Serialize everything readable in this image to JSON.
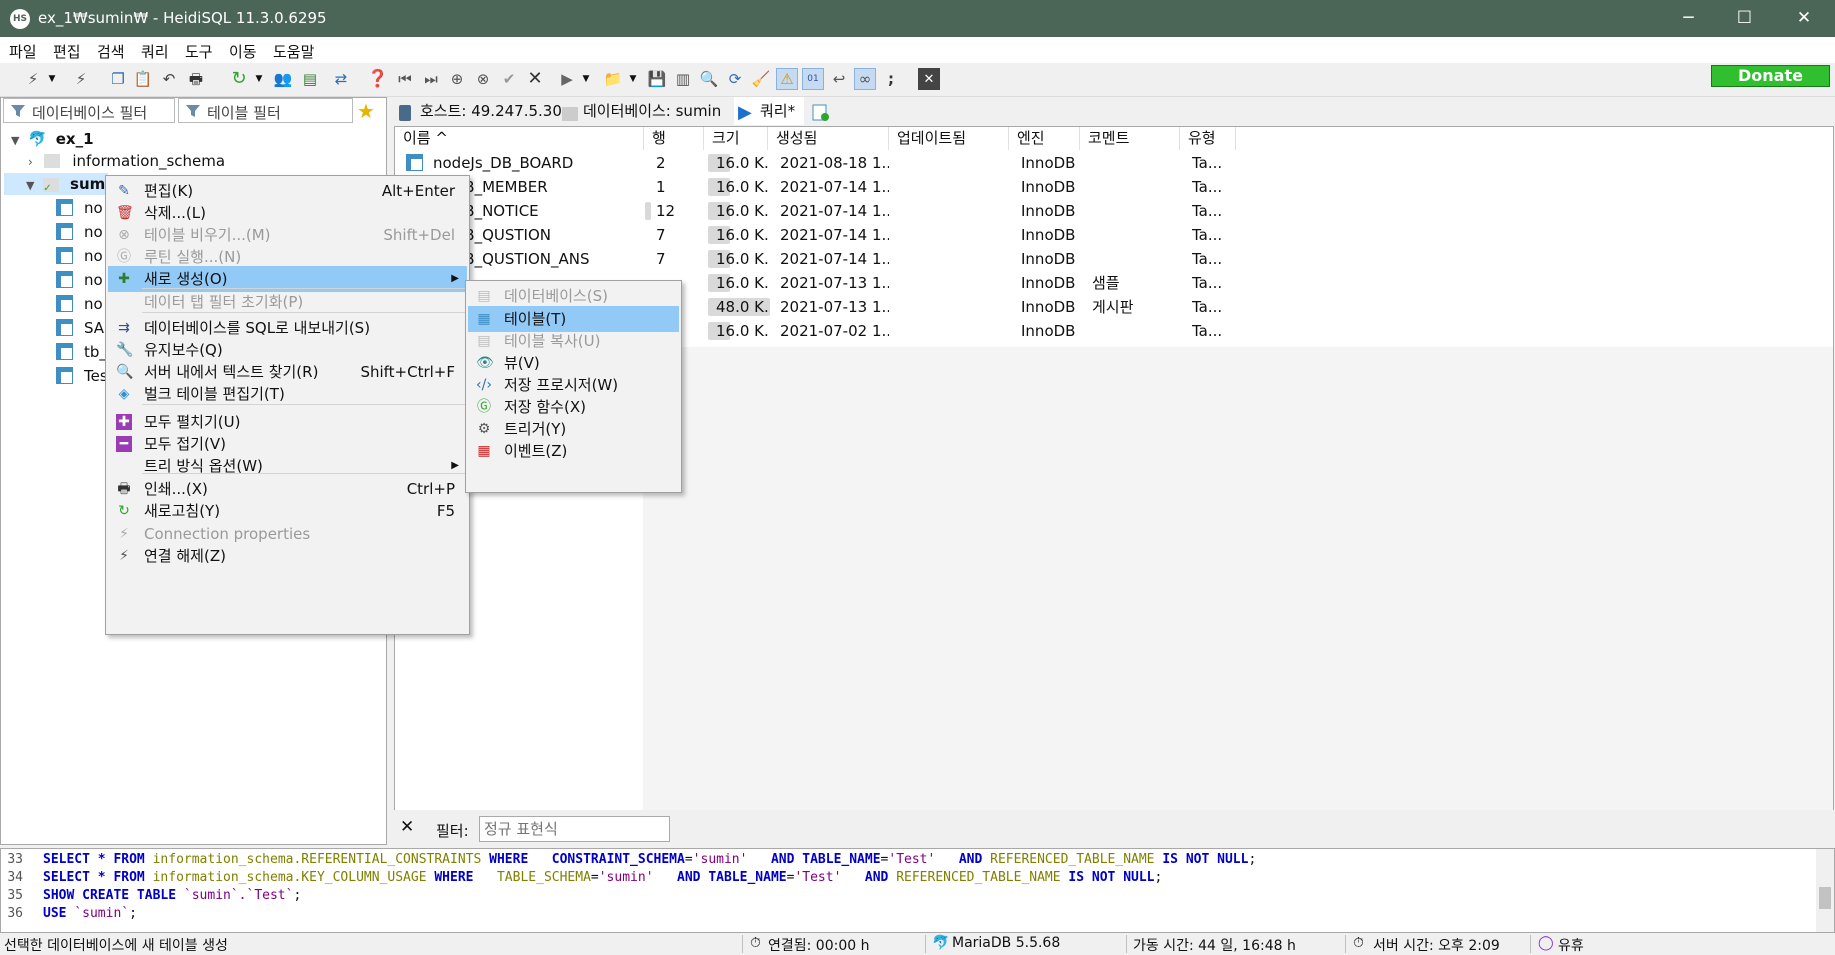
{
  "window": {
    "title": "ex_1₩sumin₩ - HeidiSQL 11.3.0.6295",
    "app_icon": "HS",
    "minimize": "─",
    "maximize": "☐",
    "close": "✕"
  },
  "menu": [
    "파일",
    "편집",
    "검색",
    "쿼리",
    "도구",
    "이동",
    "도움말"
  ],
  "toolbar": {
    "donate": "Donate"
  },
  "left": {
    "db_filter": "데이터베이스 필터",
    "table_filter": "테이블 필터",
    "tree": {
      "root": "ex_1",
      "db1": "information_schema",
      "db2": "sumi",
      "tables": [
        "no",
        "no",
        "no",
        "no",
        "no",
        "SA",
        "tb_",
        "Tes"
      ]
    }
  },
  "tabs": {
    "host": "호스트: 49.247.5.30",
    "database": "데이터베이스: sumin",
    "query": "쿼리*"
  },
  "grid": {
    "headers": [
      "이름 ^",
      "행",
      "크기",
      "생성됨",
      "업데이트됨",
      "엔진",
      "코멘트",
      "유형"
    ],
    "rows": [
      {
        "name": "nodeJs_DB_BOARD",
        "rows": "2",
        "size": "16.0 K...",
        "created": "2021-08-18 1...",
        "engine": "InnoDB",
        "comment": "",
        "type": "Ta...",
        "rows_bar": 0.0
      },
      {
        "name": "Js_DB_MEMBER",
        "rows": "1",
        "size": "16.0 K...",
        "created": "2021-07-14 1...",
        "engine": "InnoDB",
        "comment": "",
        "type": "Ta...",
        "rows_bar": 0.0
      },
      {
        "name": "Js_DB_NOTICE",
        "rows": "12",
        "size": "16.0 K...",
        "created": "2021-07-14 1...",
        "engine": "InnoDB",
        "comment": "",
        "type": "Ta...",
        "rows_bar": 0.1
      },
      {
        "name": "Js_DB_QUSTION",
        "rows": "7",
        "size": "16.0 K...",
        "created": "2021-07-14 1...",
        "engine": "InnoDB",
        "comment": "",
        "type": "Ta...",
        "rows_bar": 0.0
      },
      {
        "name": "Js_DB_QUSTION_ANS",
        "rows": "7",
        "size": "16.0 K...",
        "created": "2021-07-14 1...",
        "engine": "InnoDB",
        "comment": "",
        "type": "Ta...",
        "rows_bar": 0.0
      },
      {
        "name": "",
        "rows": "",
        "size": "16.0 K...",
        "created": "2021-07-13 1...",
        "engine": "InnoDB",
        "comment": "샘플",
        "type": "Ta..."
      },
      {
        "name": "",
        "rows": "",
        "size": "48.0 K...",
        "created": "2021-07-13 1...",
        "engine": "InnoDB",
        "comment": "게시판",
        "type": "Ta..."
      },
      {
        "name": "",
        "rows": "",
        "size": "16.0 K...",
        "created": "2021-07-02 1...",
        "engine": "InnoDB",
        "comment": "",
        "type": "Ta..."
      }
    ]
  },
  "filter": {
    "close": "✕",
    "label": "필터:",
    "placeholder": "정규 표현식"
  },
  "sql": [
    {
      "n": "33"
    },
    {
      "n": "34"
    },
    {
      "n": "35"
    },
    {
      "n": "36"
    }
  ],
  "status": {
    "message": "선택한 데이터베이스에 새 테이블 생성",
    "connected": "연결됨: 00:00 h",
    "server": "MariaDB 5.5.68",
    "uptime": "가동 시간: 44 일, 16:48 h",
    "server_time": "서버 시간: 오후 2:09",
    "idle": "유휴"
  },
  "ctx_menu": [
    {
      "label": "편집(K)",
      "shortcut": "Alt+Enter",
      "icon": "edit-icon"
    },
    {
      "label": "삭제...(L)",
      "shortcut": "",
      "icon": "delete-icon"
    },
    {
      "label": "테이블 비우기...(M)",
      "shortcut": "Shift+Del",
      "icon": "empty-icon",
      "disabled": true
    },
    {
      "label": "루틴 실행...(N)",
      "shortcut": "",
      "icon": "go-icon",
      "disabled": true
    },
    {
      "label": "새로 생성(O)",
      "shortcut": "",
      "icon": "new-icon",
      "highlight": true,
      "submenu": true
    },
    {
      "label": "데이터 탭 필터 초기화(P)",
      "shortcut": "",
      "icon": "",
      "disabled": true
    },
    {
      "label": "데이터베이스를 SQL로 내보내기(S)",
      "shortcut": "",
      "icon": "export-icon"
    },
    {
      "label": "유지보수(Q)",
      "shortcut": "",
      "icon": "wrench-icon"
    },
    {
      "label": "서버 내에서 텍스트 찾기(R)",
      "shortcut": "Shift+Ctrl+F",
      "icon": "search-icon"
    },
    {
      "label": "벌크 테이블 편집기(T)",
      "shortcut": "",
      "icon": "bulk-icon"
    },
    {
      "label": "모두 펼치기(U)",
      "shortcut": "",
      "icon": "expand-icon"
    },
    {
      "label": "모두 접기(V)",
      "shortcut": "",
      "icon": "collapse-icon"
    },
    {
      "label": "트리 방식 옵션(W)",
      "shortcut": "",
      "icon": "",
      "submenu": true
    },
    {
      "label": "인쇄...(X)",
      "shortcut": "Ctrl+P",
      "icon": "print-icon"
    },
    {
      "label": "새로고침(Y)",
      "shortcut": "F5",
      "icon": "refresh-icon"
    },
    {
      "label": "Connection properties",
      "shortcut": "",
      "icon": "connection-icon",
      "disabled": true
    },
    {
      "label": "연결 해제(Z)",
      "shortcut": "",
      "icon": "disconnect-icon"
    }
  ],
  "sub_menu": [
    {
      "label": "데이터베이스(S)",
      "icon": "database-icon",
      "disabled": true
    },
    {
      "label": "테이블(T)",
      "icon": "table-icon",
      "highlight": true
    },
    {
      "label": "테이블 복사(U)",
      "icon": "copy-table-icon",
      "disabled": true
    },
    {
      "label": "뷰(V)",
      "icon": "view-icon"
    },
    {
      "label": "저장 프로시저(W)",
      "icon": "procedure-icon"
    },
    {
      "label": "저장 함수(X)",
      "icon": "function-icon"
    },
    {
      "label": "트리거(Y)",
      "icon": "trigger-icon"
    },
    {
      "label": "이벤트(Z)",
      "icon": "event-icon"
    }
  ]
}
